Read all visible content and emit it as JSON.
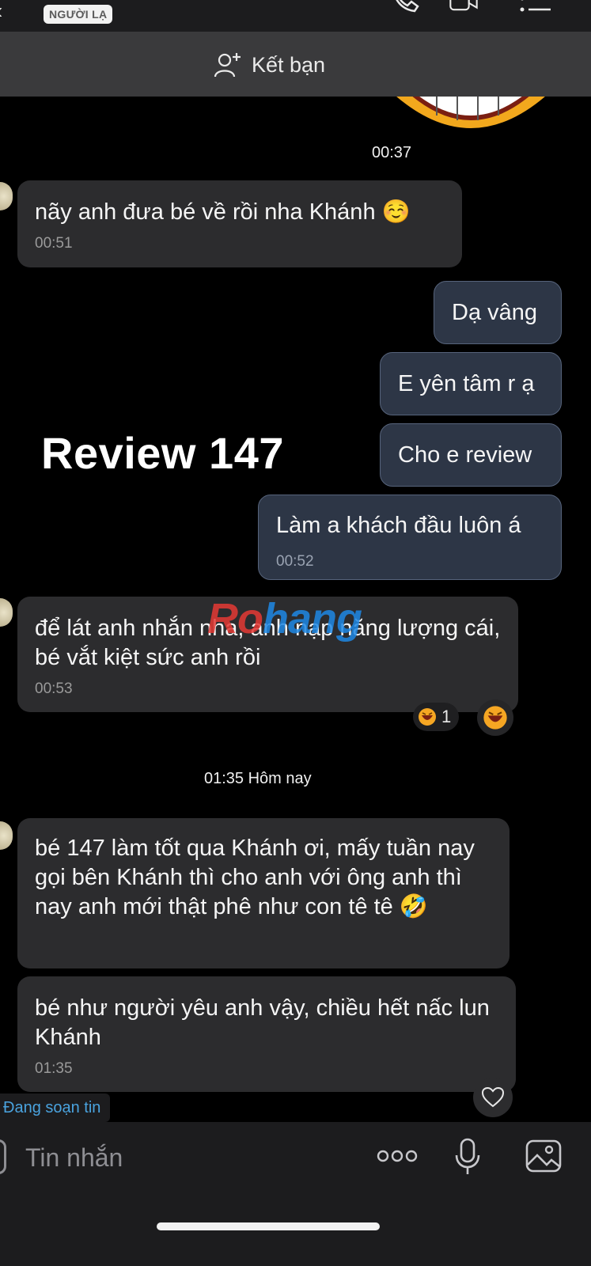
{
  "header": {
    "stranger_badge": "NGƯỜI LẠ",
    "add_friend_label": "Kết bạn"
  },
  "overlay_title": "Review 147",
  "watermark": {
    "part_a": "Ro",
    "part_b": "hang"
  },
  "messages": {
    "emoji_time": "00:37",
    "m1_text": "nãy anh đưa bé về rồi nha Khánh ☺️",
    "m1_time": "00:51",
    "m2_text": "Dạ vâng",
    "m3_text": "E yên tâm r ạ",
    "m4_text": "Cho e review",
    "m5_text": "Làm a khách đầu luôn á",
    "m5_time": "00:52",
    "m6_text": "để lát anh nhắn nha, anh nạp năng lượng cái, bé vắt kiệt sức anh rồi",
    "m6_time": "00:53",
    "m6_reaction_count": "1",
    "date_separator": "01:35 Hôm nay",
    "m7_text": "bé 147 làm tốt qua Khánh ơi, mấy tuần nay gọi bên Khánh thì cho anh với ông anh thì nay anh mới thật phê như con tê tê 🤣",
    "m8_text": "bé như người yêu anh vậy, chiều hết nấc lun Khánh",
    "m8_time": "01:35"
  },
  "typing_indicator": "Đang soạn tin",
  "composer": {
    "placeholder": "Tin nhắn"
  },
  "icons": {
    "back": "chevron-left-icon",
    "call": "phone-icon",
    "video": "video-camera-icon",
    "menu": "list-icon",
    "add_friend": "add-user-icon",
    "reaction": "laughing-face-icon",
    "heart": "heart-icon",
    "more": "more-dots-icon",
    "mic": "microphone-icon",
    "image": "image-icon"
  }
}
